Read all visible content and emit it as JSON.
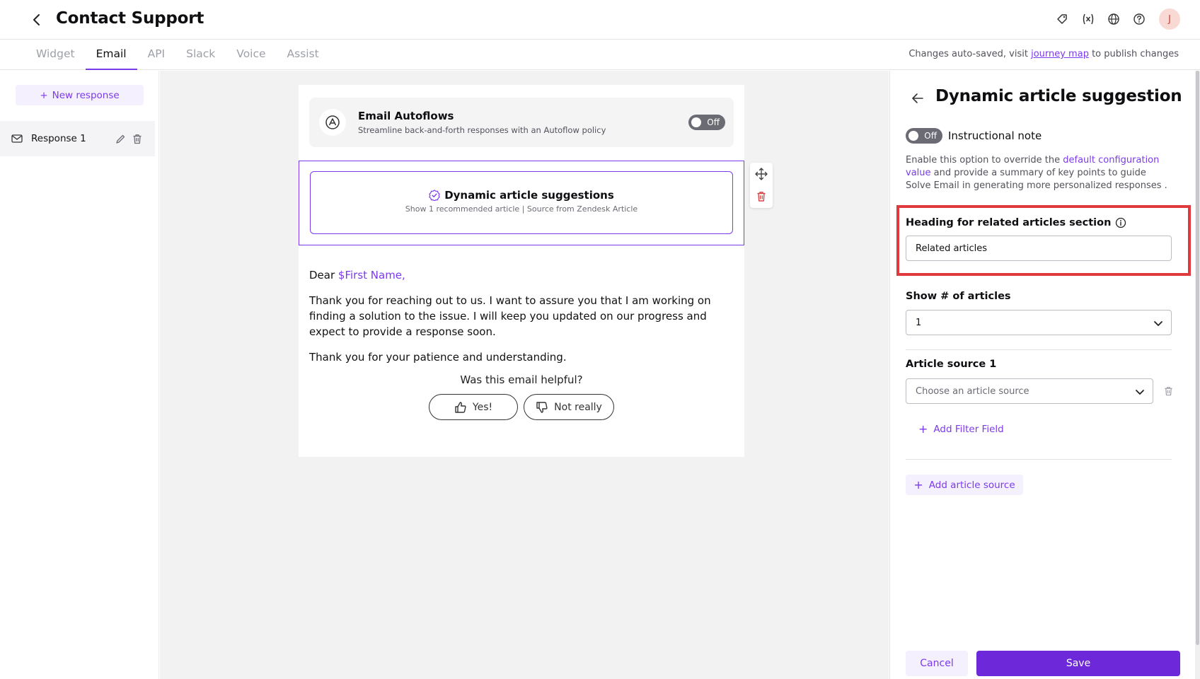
{
  "header": {
    "title": "Contact Support",
    "more": "···",
    "avatar_initial": "J"
  },
  "tabs": [
    {
      "label": "Widget",
      "active": false
    },
    {
      "label": "Email",
      "active": true
    },
    {
      "label": "API",
      "active": false
    },
    {
      "label": "Slack",
      "active": false
    },
    {
      "label": "Voice",
      "active": false
    },
    {
      "label": "Assist",
      "active": false
    }
  ],
  "autosave": {
    "prefix": "Changes auto-saved, visit ",
    "link": "journey map",
    "suffix": " to publish changes"
  },
  "sidebar": {
    "new_response": "New response",
    "items": [
      {
        "label": "Response 1"
      }
    ]
  },
  "email": {
    "autoflow_title": "Email Autoflows",
    "autoflow_sub": "Streamline back-and-forth responses with an Autoflow policy",
    "autoflow_toggle": "Off",
    "das_title": "Dynamic article suggestions",
    "das_sub": "Show 1 recommended article | Source from Zendesk Article",
    "greeting": "Dear ",
    "greeting_var": "$First Name",
    "greeting_end": ",",
    "paragraph1": "Thank you for reaching out to us. I want to assure you that I am working on finding a solution to the issue. I will keep you updated on our progress and expect to provide a response soon.",
    "paragraph2": "Thank you for your patience and understanding.",
    "helpful_question": "Was this email helpful?",
    "yes_label": "Yes!",
    "no_label": "Not really"
  },
  "panel": {
    "title": "Dynamic article suggestion",
    "note_toggle": "Off",
    "note_label": "Instructional note",
    "note_desc_prefix": "Enable this option to override the ",
    "note_desc_link": "default configuration value",
    "note_desc_suffix": " and provide a summary of key points to guide Solve Email in generating more personalized responses .",
    "heading_label": "Heading for related articles section",
    "heading_value": "Related articles",
    "count_label": "Show # of articles",
    "count_value": "1",
    "source_label": "Article source 1",
    "source_placeholder": "Choose an article source",
    "add_filter": "Add Filter Field",
    "add_source": "Add article source",
    "cancel": "Cancel",
    "save": "Save"
  },
  "colors": {
    "accent": "#7c3aed",
    "primary_button": "#6d28d9",
    "highlight_border": "#e0393e",
    "delete_red": "#d64545"
  }
}
